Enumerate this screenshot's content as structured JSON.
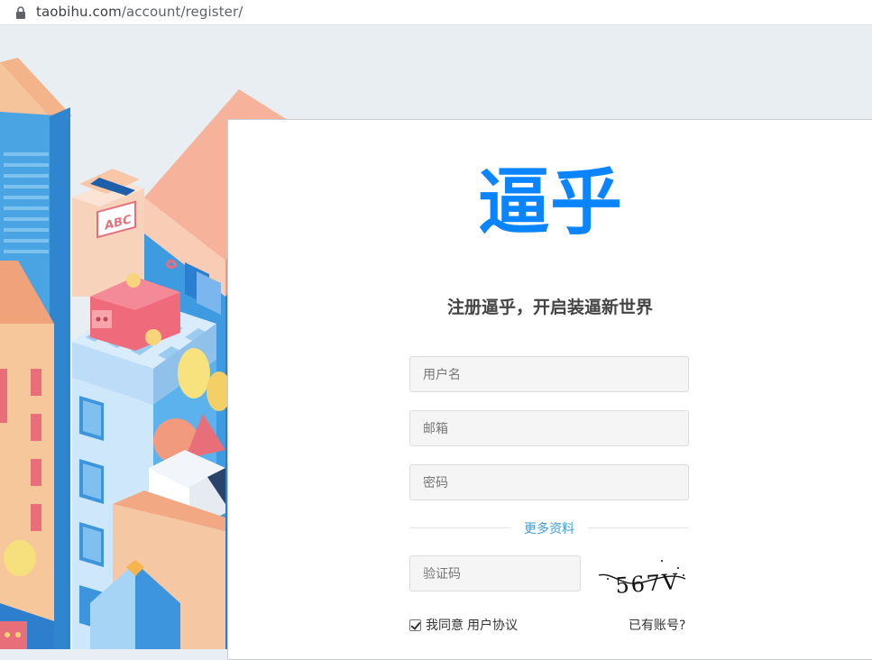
{
  "browser": {
    "url_host": "taobihu.com",
    "url_path": "/account/register/"
  },
  "illustration": {
    "sign_text": "ABC"
  },
  "register": {
    "logo": "逼乎",
    "subtitle": "注册逼乎，开启装逼新世界",
    "username_placeholder": "用户名",
    "email_placeholder": "邮箱",
    "password_placeholder": "密码",
    "more_info_label": "更多资料",
    "captcha_placeholder": "验证码",
    "captcha_text": "567V",
    "agree_label": "我同意",
    "agreement_link": "用户协议",
    "have_account_link": "已有账号?",
    "agree_checked": true
  },
  "colors": {
    "brand": "#0a84ff",
    "link_accent": "#3e9bd5",
    "input_bg": "#f5f5f5"
  }
}
